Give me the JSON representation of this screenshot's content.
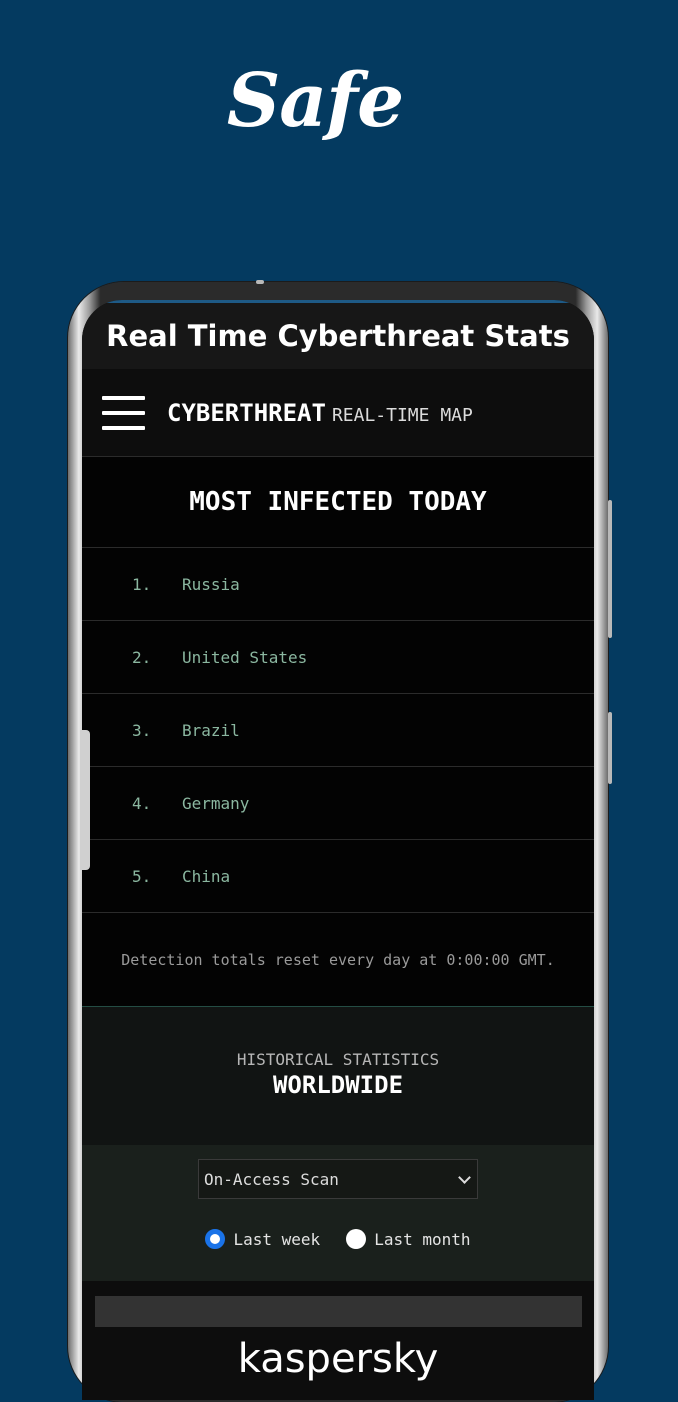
{
  "promo": {
    "title": "Safe"
  },
  "app_bar": {
    "title": "Real Time Cyberthreat Stats"
  },
  "site_header": {
    "brand_main": "CYBERTHREAT",
    "brand_sub": "REAL-TIME MAP",
    "menu_icon": "hamburger-menu-icon"
  },
  "infected": {
    "title": "MOST INFECTED TODAY",
    "items": [
      {
        "rank": "1.",
        "country": "Russia"
      },
      {
        "rank": "2.",
        "country": "United States"
      },
      {
        "rank": "3.",
        "country": "Brazil"
      },
      {
        "rank": "4.",
        "country": "Germany"
      },
      {
        "rank": "5.",
        "country": "China"
      }
    ],
    "footnote": "Detection totals reset every day at 0:00:00 GMT."
  },
  "historical": {
    "label": "HISTORICAL STATISTICS",
    "region": "WORLDWIDE",
    "scan_select": {
      "value": "On-Access Scan"
    },
    "period_options": [
      {
        "label": "Last week",
        "selected": true
      },
      {
        "label": "Last month",
        "selected": false
      }
    ]
  },
  "footer": {
    "logo_text": "kaspersky"
  },
  "colors": {
    "background": "#043a60",
    "radio_accent": "#1a73e8",
    "country_text": "#8bb7a0"
  }
}
